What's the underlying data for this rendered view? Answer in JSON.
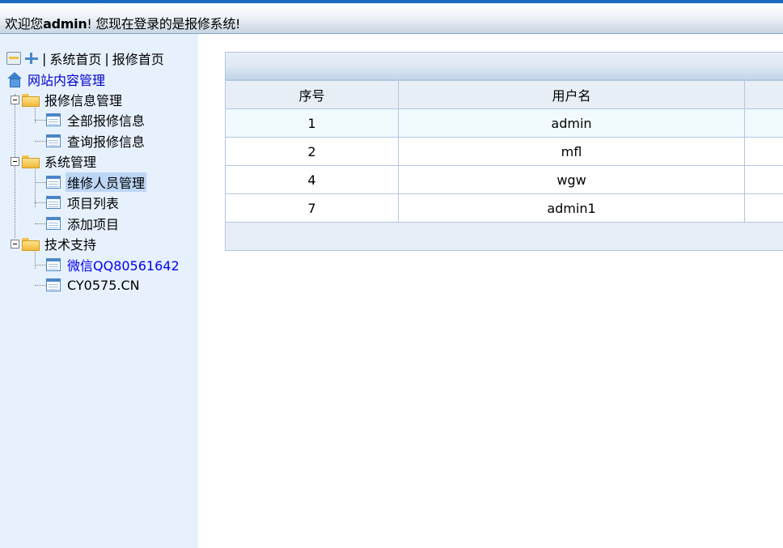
{
  "header": {
    "welcome_prefix": "欢迎您",
    "username": "admin",
    "welcome_suffix": "! 您现在登录的是报修系统!"
  },
  "sidebar": {
    "toolbar": {
      "separator": "|",
      "home_link": "系统首页",
      "repair_home_link": "报修首页"
    },
    "root": {
      "label": "网站内容管理",
      "icon": "home-icon"
    },
    "groups": [
      {
        "label": "报修信息管理",
        "items": [
          {
            "label": "全部报修信息"
          },
          {
            "label": "查询报修信息"
          }
        ]
      },
      {
        "label": "系统管理",
        "items": [
          {
            "label": "维修人员管理",
            "selected": true
          },
          {
            "label": "项目列表"
          },
          {
            "label": "添加项目"
          }
        ]
      },
      {
        "label": "技术支持",
        "items": [
          {
            "label": "微信QQ80561642",
            "color": "#0000ee"
          },
          {
            "label": "CY0575.CN"
          }
        ]
      }
    ]
  },
  "grid": {
    "columns": [
      "序号",
      "用户名",
      ""
    ],
    "rows": [
      {
        "id": "1",
        "username": "admin"
      },
      {
        "id": "2",
        "username": "mfl"
      },
      {
        "id": "4",
        "username": "wgw"
      },
      {
        "id": "7",
        "username": "admin1"
      }
    ]
  },
  "colors": {
    "header_border": "#1a6bbf",
    "sidebar_bg": "#e6f1fd",
    "grid_border": "#b3c7de",
    "selected_bg": "#bdd6f5",
    "link_blue": "#0000ee"
  }
}
